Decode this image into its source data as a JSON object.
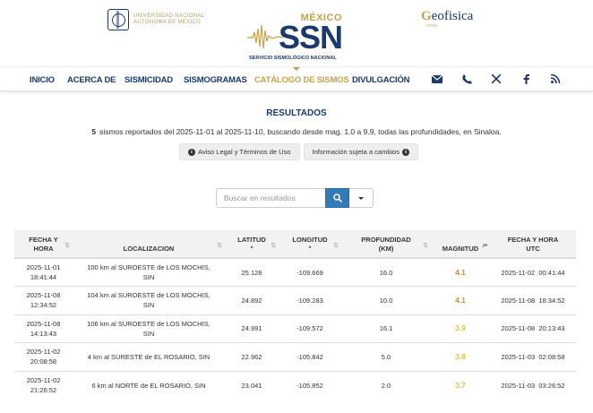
{
  "header": {
    "unam_text": [
      "UNIVERSIDAD NACIONAL",
      "AUTÓNOMA DE MÉXICO"
    ],
    "ssn_country": "MÉXICO",
    "ssn_acronym": "SSN",
    "ssn_full": "SERVICIO SISMOLÓGICO NACIONAL",
    "geofisica_logo": "GEOFISICA",
    "geofisica_sub": "UNAM"
  },
  "nav": {
    "items": [
      "INICIO",
      "ACERCA DE",
      "SISMICIDAD",
      "SISMOGRAMAS",
      "CATÁLOGO DE SISMOS",
      "DIVULGACIÓN"
    ],
    "active": "CATÁLOGO DE SISMOS",
    "icons": [
      "envelope-icon",
      "phone-icon",
      "x-twitter-icon",
      "facebook-icon",
      "rss-icon"
    ]
  },
  "results": {
    "title": "RESULTADOS",
    "count": "5",
    "summary": "sismos reportados del 2025-11-01 al 2025-11-10, buscando desde mag. 1.0 a 9.9, todas las profundidades, en Sinaloa.",
    "legal_button": "Aviso Legal y Términos de Uso",
    "info_button": "Información sujeta a cambios"
  },
  "search": {
    "placeholder": "Buscar en resultados"
  },
  "table": {
    "headers": [
      "FECHA Y HORA",
      "LOCALIZACION",
      "LATITUD °",
      "LONGITUD °",
      "PROFUNDIDAD (KM)",
      "MAGNITUD",
      "FECHA Y HORA UTC"
    ],
    "rows": [
      {
        "fecha": "2025-11-01",
        "hora": "18:41:44",
        "loc1": "100 km al SUROESTE de LOS MOCHIS,",
        "loc2": "SIN",
        "lat": "25.128",
        "lon": "-109.669",
        "prof": "16.0",
        "mag": "4.1",
        "utc": "2025-11-02  00:41:44",
        "color": "#e08a1e"
      },
      {
        "fecha": "2025-11-08",
        "hora": "12:34:52",
        "loc1": "104 km al SUROESTE de LOS MOCHIS,",
        "loc2": "SIN",
        "lat": "24.892",
        "lon": "-109.283",
        "prof": "10.0",
        "mag": "4.1",
        "utc": "2025-11-08  18:34:52",
        "color": "#e08a1e"
      },
      {
        "fecha": "2025-11-08",
        "hora": "14:13:43",
        "loc1": "106 km al SUROESTE de LOS MOCHIS,",
        "loc2": "SIN",
        "lat": "24.991",
        "lon": "-109.572",
        "prof": "16.1",
        "mag": "3.9",
        "utc": "2025-11-08  20:13:43",
        "color": "#e8c13a"
      },
      {
        "fecha": "2025-11-02",
        "hora": "20:08:58",
        "loc1": "4 km al SURESTE de EL ROSARIO, SIN",
        "loc2": "",
        "lat": "22.962",
        "lon": "-105.842",
        "prof": "5.0",
        "mag": "3.8",
        "utc": "2025-11-03  02:08:58",
        "color": "#e8c13a"
      },
      {
        "fecha": "2025-11-02",
        "hora": "21:26:52",
        "loc1": "6 km al NORTE de EL ROSARIO, SIN",
        "loc2": "",
        "lat": "23.041",
        "lon": "-105.852",
        "prof": "2.0",
        "mag": "3.7",
        "utc": "2025-11-03  03:26:52",
        "color": "#e8c13a"
      }
    ]
  }
}
